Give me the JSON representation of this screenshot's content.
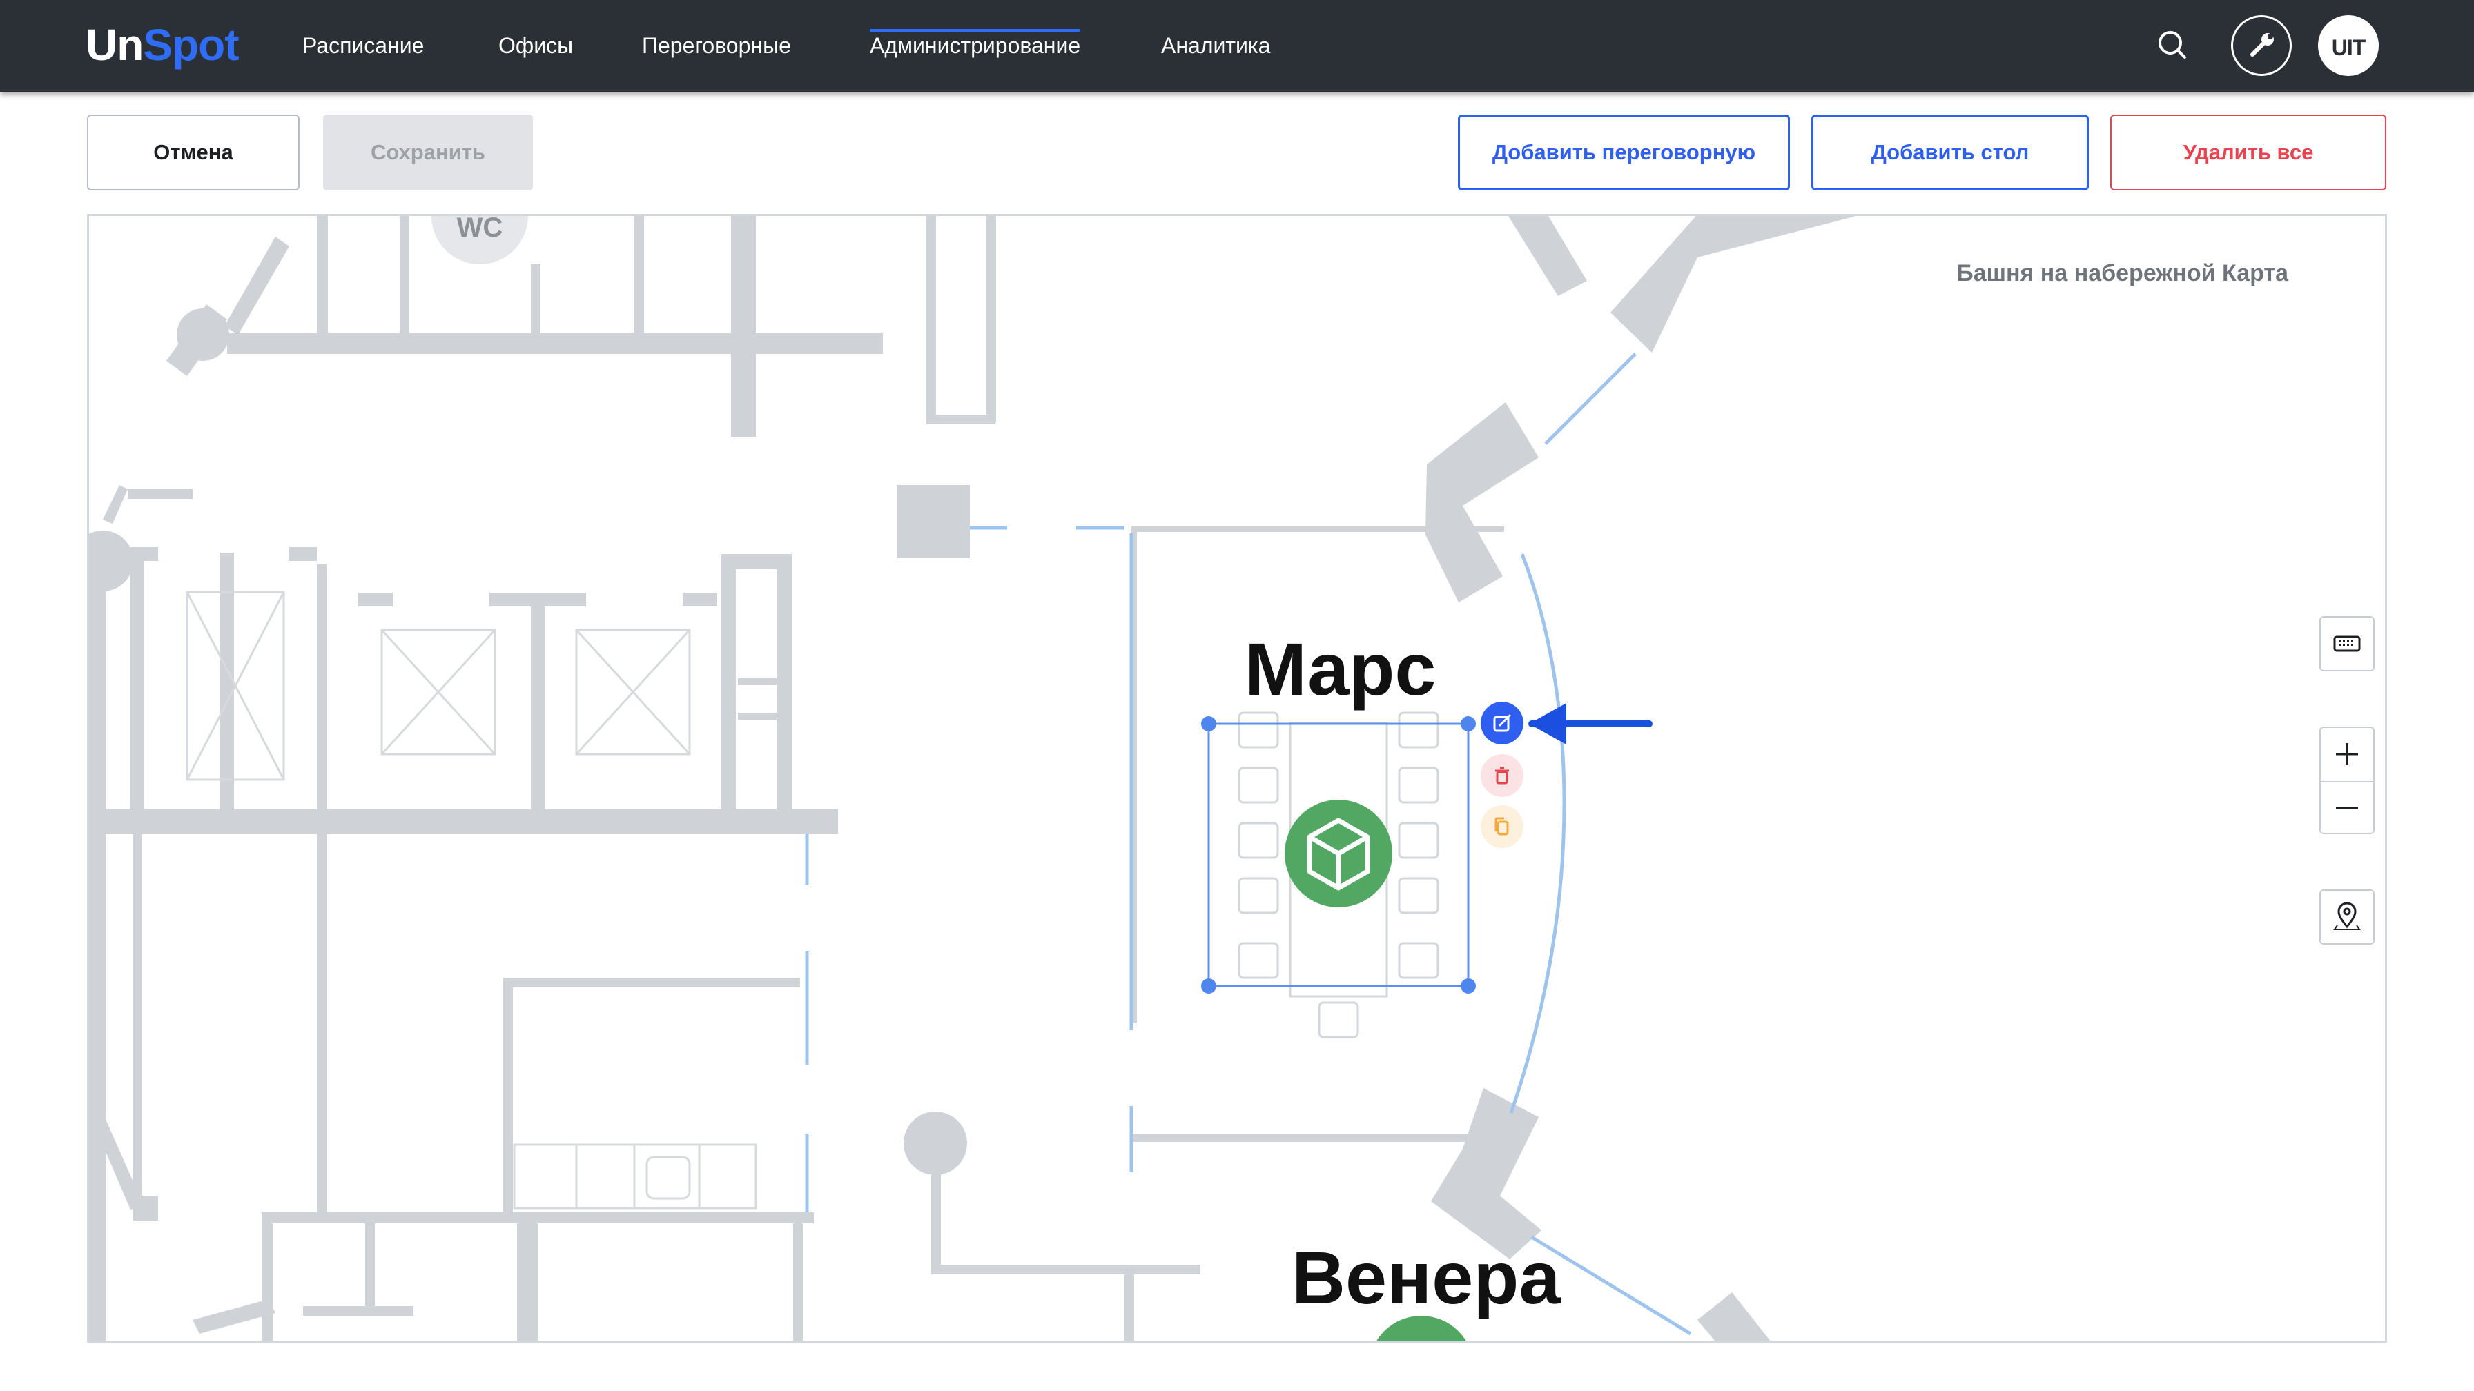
{
  "header": {
    "logo_un": "Un",
    "logo_spot": "Spot",
    "nav": [
      {
        "label": "Расписание"
      },
      {
        "label": "Офисы"
      },
      {
        "label": "Переговорные"
      },
      {
        "label": "Администрирование",
        "active": true
      },
      {
        "label": "Аналитика"
      }
    ],
    "search_icon": "search-icon",
    "tools_icon": "wrench-icon",
    "avatar_text": "UIT"
  },
  "toolbar": {
    "cancel_label": "Отмена",
    "save_label": "Сохранить",
    "add_room_label": "Добавить переговорную",
    "add_desk_label": "Добавить стол",
    "delete_all_label": "Удалить все"
  },
  "map": {
    "title": "Башня на набережной Карта",
    "rooms": [
      {
        "name": "Марс",
        "selected": true
      },
      {
        "name": "Венера"
      }
    ],
    "wc_label": "WC",
    "room_actions": [
      "edit-icon",
      "trash-icon",
      "copy-icon"
    ],
    "controls": [
      "keyboard-icon",
      "zoom-in-icon",
      "zoom-out-icon",
      "location-pin-icon"
    ]
  },
  "colors": {
    "header_bg": "#2b2f36",
    "accent": "#2f6df6",
    "danger": "#e8434f",
    "room_marker": "#52a862",
    "wall": "#cfd3d8",
    "glass_wall": "#9ec4ee"
  }
}
